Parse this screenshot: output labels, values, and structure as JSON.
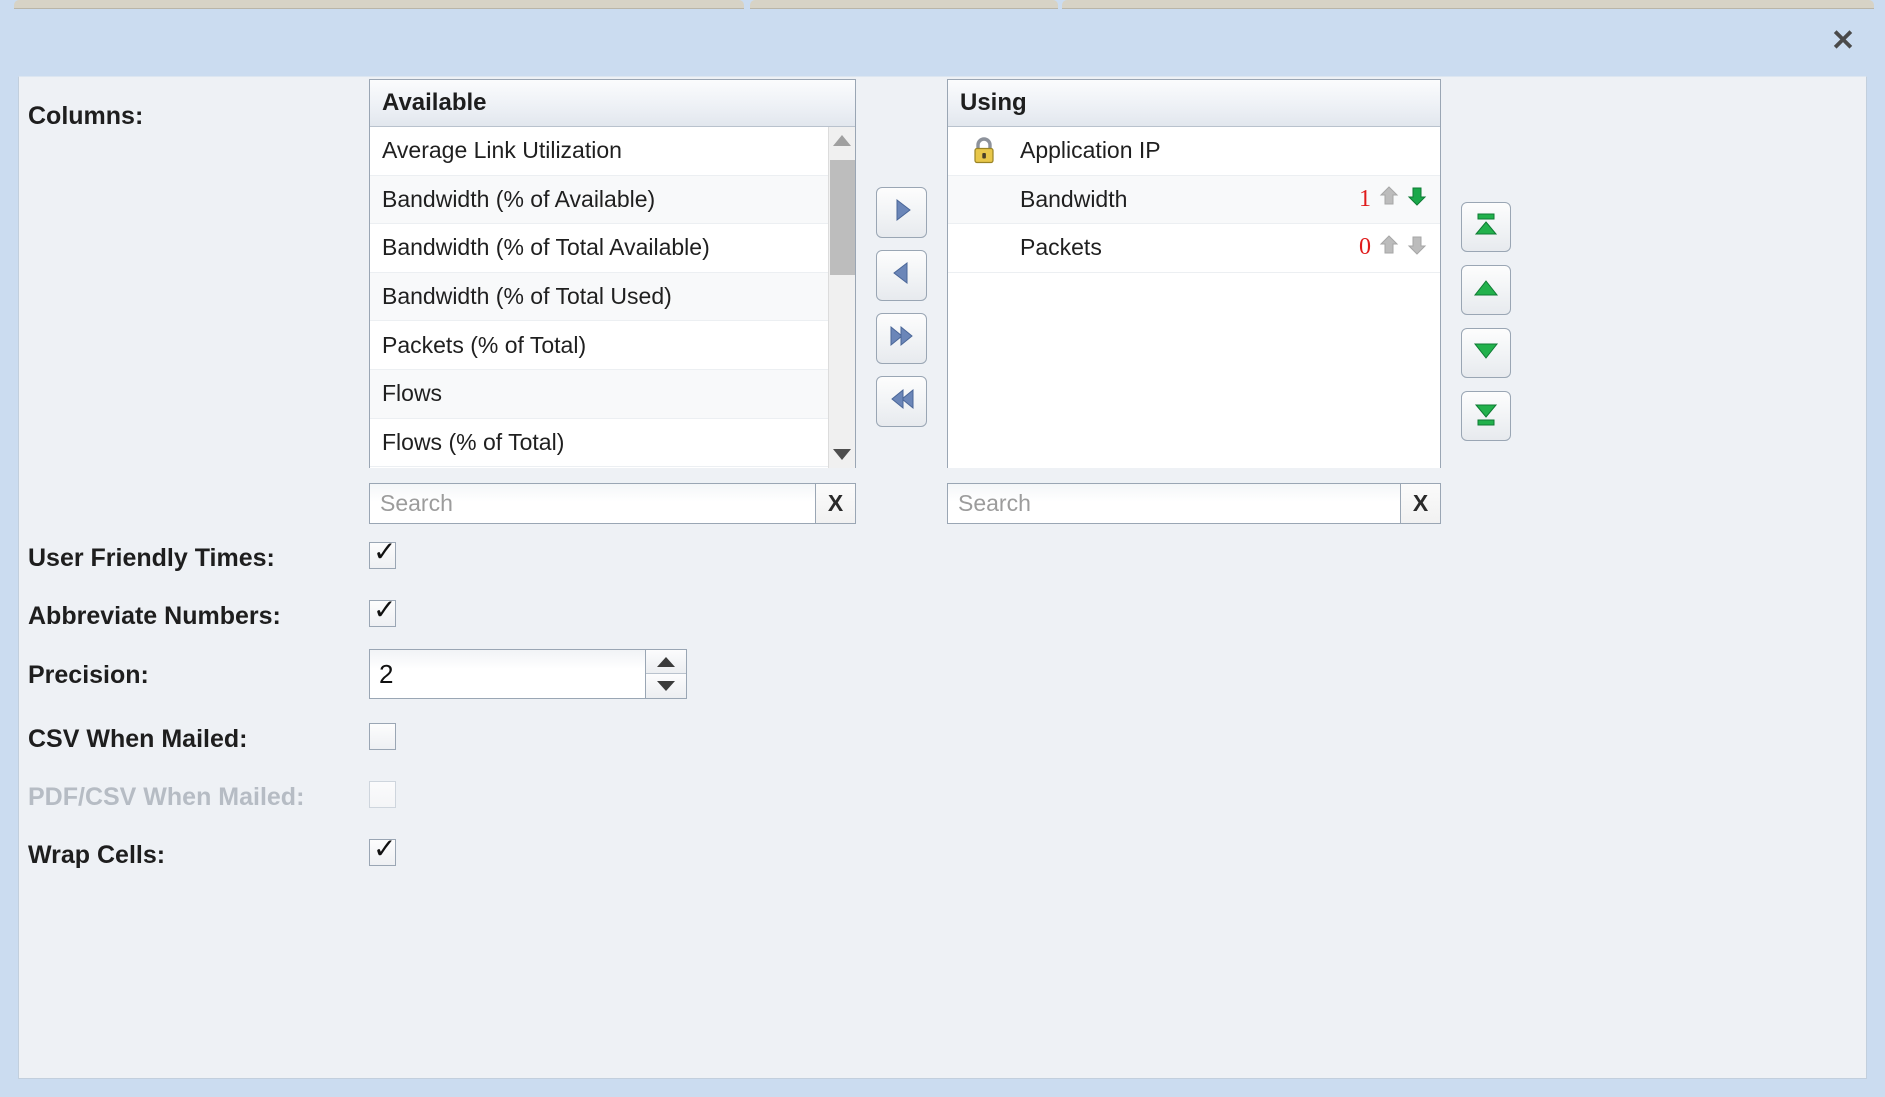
{
  "window": {
    "close_label": "✕"
  },
  "columns_section": {
    "label": "Columns:",
    "available": {
      "header": "Available",
      "items": [
        "Average Link Utilization",
        "Bandwidth (% of Available)",
        "Bandwidth (% of Total Available)",
        "Bandwidth (% of Total Used)",
        "Packets (% of Total)",
        "Flows",
        "Flows (% of Total)"
      ],
      "search": {
        "value": "",
        "placeholder": "Search",
        "clear_label": "X"
      }
    },
    "using": {
      "header": "Using",
      "items": [
        {
          "label": "Application IP",
          "locked": true,
          "sort_index": null,
          "sort_dir": null
        },
        {
          "label": "Bandwidth",
          "locked": false,
          "sort_index": "1",
          "sort_dir": "down"
        },
        {
          "label": "Packets",
          "locked": false,
          "sort_index": "0",
          "sort_dir": "none"
        }
      ],
      "search": {
        "value": "",
        "placeholder": "Search",
        "clear_label": "X"
      }
    },
    "transfer_buttons": [
      {
        "name": "add-selected",
        "icon": "arrow-right-icon"
      },
      {
        "name": "remove-selected",
        "icon": "arrow-left-icon"
      },
      {
        "name": "add-all",
        "icon": "double-arrow-right-icon"
      },
      {
        "name": "remove-all",
        "icon": "double-arrow-left-icon"
      }
    ],
    "reorder_buttons": [
      {
        "name": "move-to-top",
        "icon": "move-to-top-icon"
      },
      {
        "name": "move-up",
        "icon": "move-up-icon"
      },
      {
        "name": "move-down",
        "icon": "move-down-icon"
      },
      {
        "name": "move-to-bottom",
        "icon": "move-to-bottom-icon"
      }
    ]
  },
  "options": {
    "user_friendly_times": {
      "label": "User Friendly Times:",
      "checked": true,
      "disabled": false
    },
    "abbreviate_numbers": {
      "label": "Abbreviate Numbers:",
      "checked": true,
      "disabled": false
    },
    "precision": {
      "label": "Precision:",
      "value": "2"
    },
    "csv_when_mailed": {
      "label": "CSV When Mailed:",
      "checked": false,
      "disabled": false
    },
    "pdf_csv_when_mailed": {
      "label": "PDF/CSV When Mailed:",
      "checked": false,
      "disabled": true
    },
    "wrap_cells": {
      "label": "Wrap Cells:",
      "checked": true,
      "disabled": false
    }
  },
  "colors": {
    "titlebar": "#cbdcf0",
    "panel_bg": "#eef1f5",
    "sort_number": "#e01b1b",
    "sort_active_arrow": "#1aa84a",
    "sort_inactive_arrow": "#b8b8b8",
    "reorder_arrow": "#22b14c",
    "transfer_arrow": "#6b86b8",
    "lock_body": "#e8c74a"
  }
}
